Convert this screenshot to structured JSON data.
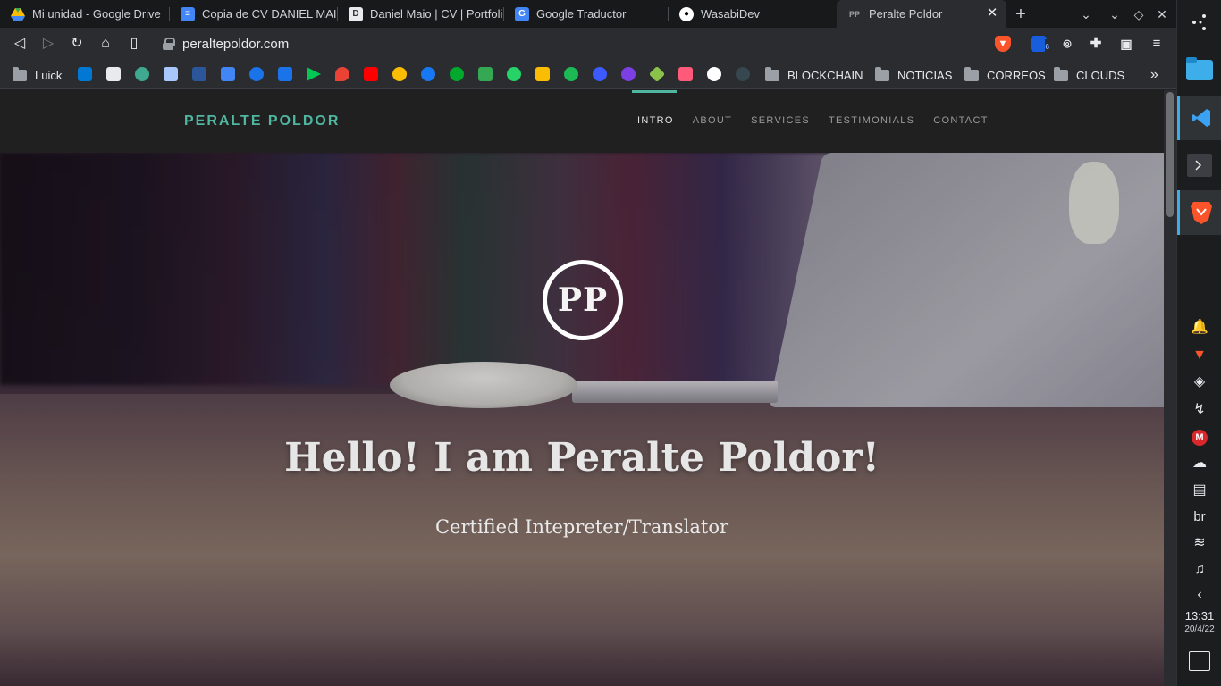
{
  "tabs": [
    {
      "title": "Mi unidad - Google Drive",
      "icon": "google-drive-icon"
    },
    {
      "title": "Copia de CV DANIEL MAIO",
      "icon": "google-docs-icon"
    },
    {
      "title": "Daniel Maio | CV | Portfolio",
      "icon": "portfolio-icon"
    },
    {
      "title": "Google Traductor",
      "icon": "google-translate-icon"
    },
    {
      "title": "WasabiDev",
      "icon": "github-icon"
    },
    {
      "title": "Peralte Poldor",
      "icon": "site-icon",
      "active": true
    }
  ],
  "toolbar": {
    "url": "peraltepoldor.com",
    "extension_badge": "6"
  },
  "bookmarks": {
    "profile_label": "Luick",
    "folders": [
      "BLOCKCHAIN",
      "NOTICIAS",
      "CORREOS",
      "CLOUDS"
    ],
    "overflow": "»"
  },
  "site": {
    "brand": "PERALTE POLDOR",
    "menu": [
      "INTRO",
      "ABOUT",
      "SERVICES",
      "TESTIMONIALS",
      "CONTACT"
    ],
    "active_menu": "INTRO",
    "logo_text": "PP",
    "hero_title": "Hello! I am Peralte Poldor!",
    "hero_subtitle": "Certified Intepreter/Translator",
    "accent_color": "#4fb6a0"
  },
  "system": {
    "keyboard_layout": "br",
    "time": "13:31",
    "date": "20/4/22"
  }
}
